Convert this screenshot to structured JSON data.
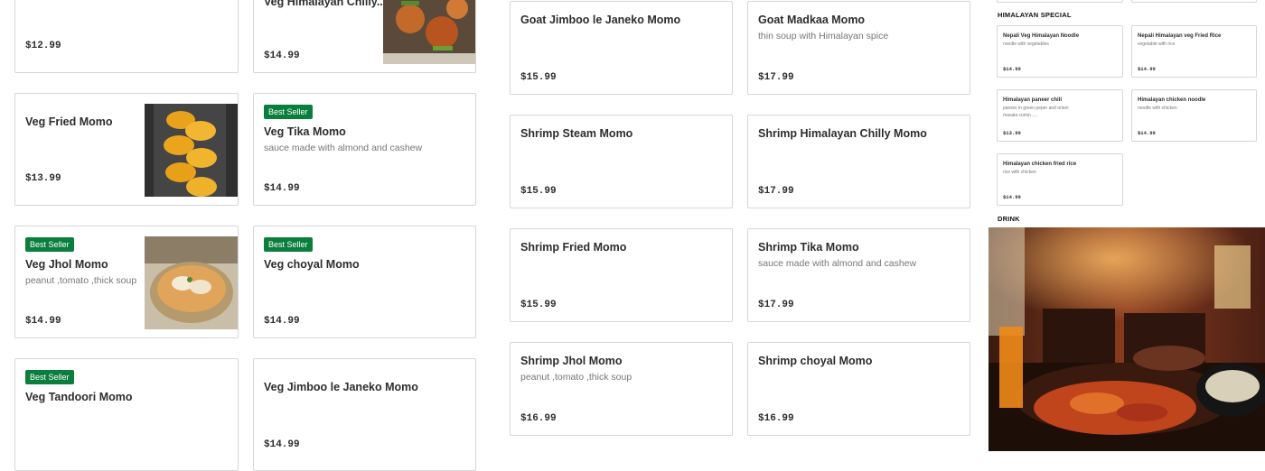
{
  "column1": [
    {
      "price": "$12.99"
    },
    {
      "name": "Veg Fried Momo",
      "price": "$13.99"
    },
    {
      "badge": "Best Seller",
      "name": "Veg Jhol Momo",
      "desc": "peanut ,tomato ,thick soup",
      "price": "$14.99"
    },
    {
      "badge": "Best Seller",
      "name": "Veg Tandoori Momo"
    }
  ],
  "column2": [
    {
      "name": "Veg Himalayan Chilly...",
      "price": "$14.99"
    },
    {
      "badge": "Best Seller",
      "name": "Veg Tika Momo",
      "desc": "sauce made with almond and cashew",
      "price": "$14.99"
    },
    {
      "badge": "Best Seller",
      "name": "Veg choyal Momo",
      "price": "$14.99"
    },
    {
      "name": "Veg Jimboo le Janeko Momo",
      "price": "$14.99"
    }
  ],
  "column3": [
    {
      "name": "Goat Jimboo le Janeko Momo",
      "price": "$15.99"
    },
    {
      "name": "Shrimp Steam Momo",
      "price": "$15.99"
    },
    {
      "name": "Shrimp Fried Momo",
      "price": "$15.99"
    },
    {
      "name": "Shrimp Jhol Momo",
      "desc": "peanut ,tomato ,thick soup",
      "price": "$16.99"
    }
  ],
  "column4": [
    {
      "name": "Goat Madkaa Momo",
      "desc": "thin soup with Himalayan spice",
      "price": "$17.99"
    },
    {
      "name": "Shrimp Himalayan Chilly Momo",
      "price": "$17.99"
    },
    {
      "name": "Shrimp Tika Momo",
      "desc": "sauce made with almond and cashew",
      "price": "$17.99"
    },
    {
      "name": "Shrimp choyal Momo",
      "price": "$16.99"
    }
  ],
  "himalayan_special": {
    "heading": "HIMALAYAN SPECIAL",
    "items": [
      {
        "name": "Nepali Veg Himalayan Noodle",
        "desc": "noodle with vegetables",
        "price": "$14.99"
      },
      {
        "name": "Nepali Himalayan veg Fried Rice",
        "desc": "vegetable with rice",
        "price": "$14.99"
      },
      {
        "name": "Himalayan paneer chili",
        "desc": "paneer in green peper and onion masala cumin ....",
        "price": "$13.99"
      },
      {
        "name": "Himalayan chicken noodle",
        "desc": "noodle with chicken",
        "price": "$14.99"
      },
      {
        "name": "Himalayan chicken fried rice",
        "desc": "rice with chicken",
        "price": "$14.99"
      }
    ]
  },
  "drink": {
    "heading": "DRINK"
  },
  "colors": {
    "badge": "#0a7e3c",
    "border": "#d6d6d6",
    "text": "#2d2d2d",
    "muted": "#767676"
  }
}
